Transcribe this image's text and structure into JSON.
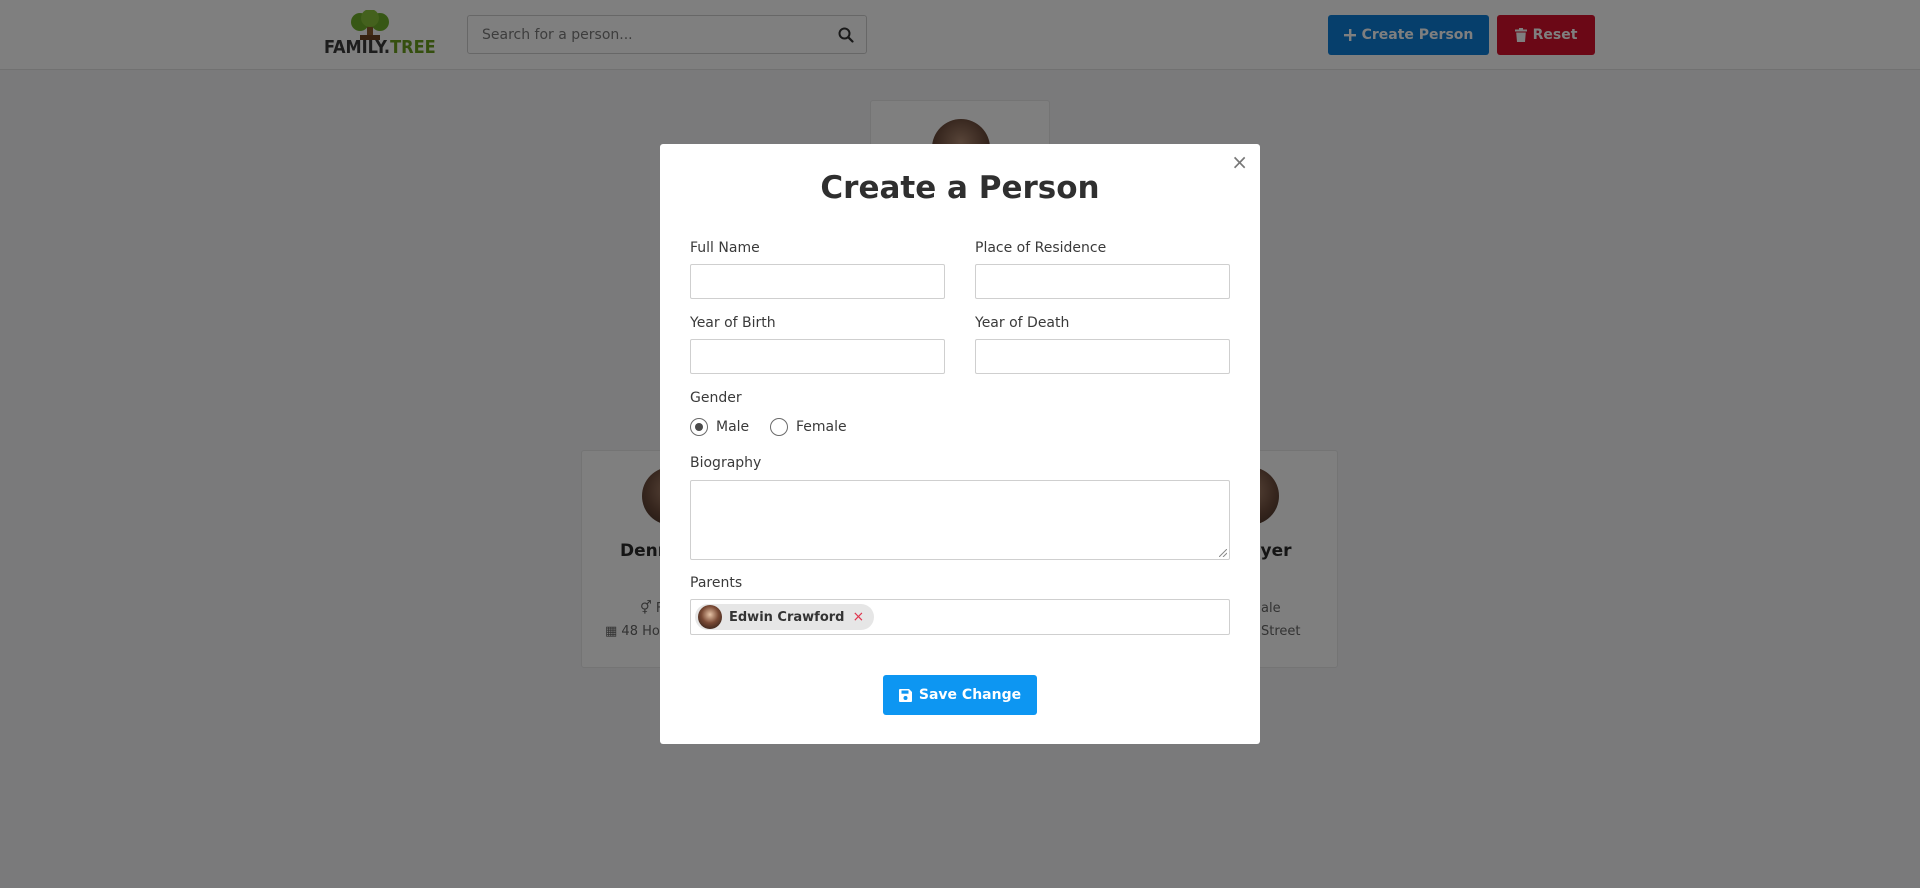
{
  "header": {
    "logo": {
      "text_primary": "FAMILY.",
      "text_secondary": "TREE"
    },
    "search": {
      "placeholder": "Search for a person..."
    },
    "create_button_label": "Create Person",
    "reset_button_label": "Reset"
  },
  "background_cards": {
    "left": {
      "name_fragment": "Denn",
      "meta_gender_fragment": "F",
      "meta_address_fragment": "48 Ho"
    },
    "right": {
      "name_fragment": "eyer",
      "meta_gender_fragment": "ale",
      "meta_address_fragment": "Street"
    }
  },
  "modal": {
    "title": "Create a Person",
    "close_label": "×",
    "fields": {
      "full_name": {
        "label": "Full Name",
        "value": ""
      },
      "residence": {
        "label": "Place of Residence",
        "value": ""
      },
      "birth_year": {
        "label": "Year of Birth",
        "value": ""
      },
      "death_year": {
        "label": "Year of Death",
        "value": ""
      },
      "gender": {
        "label": "Gender",
        "options": [
          "Male",
          "Female"
        ],
        "selected": "Male"
      },
      "biography": {
        "label": "Biography",
        "value": ""
      },
      "parents": {
        "label": "Parents",
        "selected": [
          {
            "name": "Edwin Crawford"
          }
        ],
        "remove_label": "×"
      }
    },
    "save_button_label": "Save Change"
  },
  "colors": {
    "create_button": "#0d7fd8",
    "reset_button": "#d6102c",
    "save_button": "#0d96f2",
    "logo_green": "#6b9e1f"
  }
}
